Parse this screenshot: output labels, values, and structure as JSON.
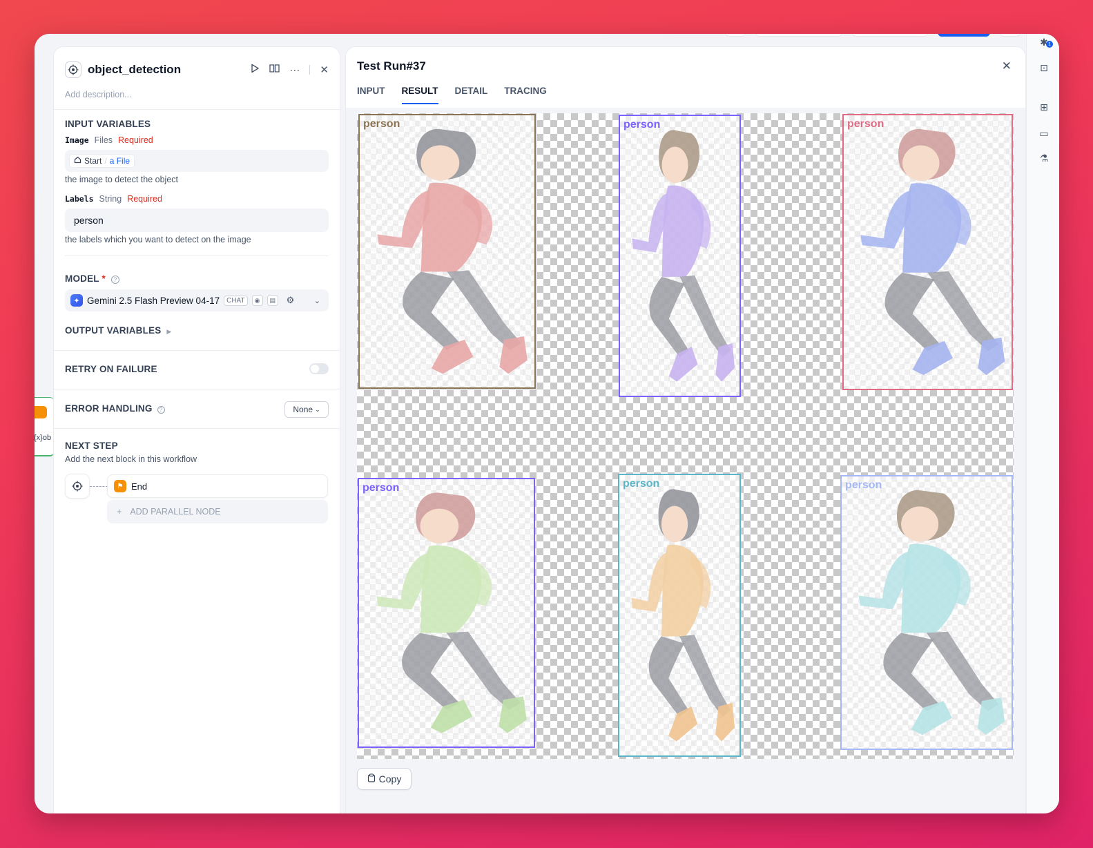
{
  "node": {
    "title": "object_detection",
    "description_placeholder": "Add description..."
  },
  "input_variables": {
    "title": "INPUT VARIABLES",
    "image": {
      "name": "Image",
      "type": "Files",
      "required": "Required",
      "source_node": "Start",
      "source_var": "a File",
      "hint": "the image to detect the object"
    },
    "labels": {
      "name": "Labels",
      "type": "String",
      "required": "Required",
      "value": "person",
      "hint": "the labels which you want to detect on the image"
    }
  },
  "model": {
    "title": "MODEL",
    "required_mark": "*",
    "name": "Gemini 2.5 Flash Preview 04-17",
    "tag": "CHAT"
  },
  "output_variables": {
    "title": "OUTPUT VARIABLES"
  },
  "retry": {
    "title": "RETRY ON FAILURE",
    "enabled": false
  },
  "error_handling": {
    "title": "ERROR HANDLING",
    "value": "None"
  },
  "next_step": {
    "title": "NEXT STEP",
    "hint": "Add the next block in this workflow",
    "end_label": "End",
    "parallel_label": "ADD PARALLEL NODE"
  },
  "canvas": {
    "partial_label": "{x}ob"
  },
  "test_run": {
    "title": "Test Run#37",
    "tabs": [
      "INPUT",
      "RESULT",
      "DETAIL",
      "TRACING"
    ],
    "active_tab": "RESULT",
    "copy_label": "Copy",
    "detections": [
      {
        "label": "person",
        "color": "#8b7355",
        "shirt": "#e8a6a6",
        "hair": "#8e9098",
        "shoe": "#e8a6a6"
      },
      {
        "label": "person",
        "color": "#7b61ff",
        "shirt": "#c7b3f0",
        "hair": "#a89684",
        "shoe": "#c7b3f0"
      },
      {
        "label": "person",
        "color": "#e06b84",
        "shirt": "#a5b4f0",
        "hair": "#cf9a9a",
        "shoe": "#a5b4f0"
      },
      {
        "label": "person",
        "color": "#7b61ff",
        "shirt": "#cde8b8",
        "hair": "#cf9a9a",
        "shoe": "#bfe0a8"
      },
      {
        "label": "person",
        "color": "#5bb5c8",
        "shirt": "#f2cfa2",
        "hair": "#8e9098",
        "shoe": "#efc38f"
      },
      {
        "label": "person",
        "color": "#a5b8f5",
        "shirt": "#b6e3e6",
        "hair": "#a89684",
        "shoe": "#b6e3e6"
      }
    ]
  }
}
